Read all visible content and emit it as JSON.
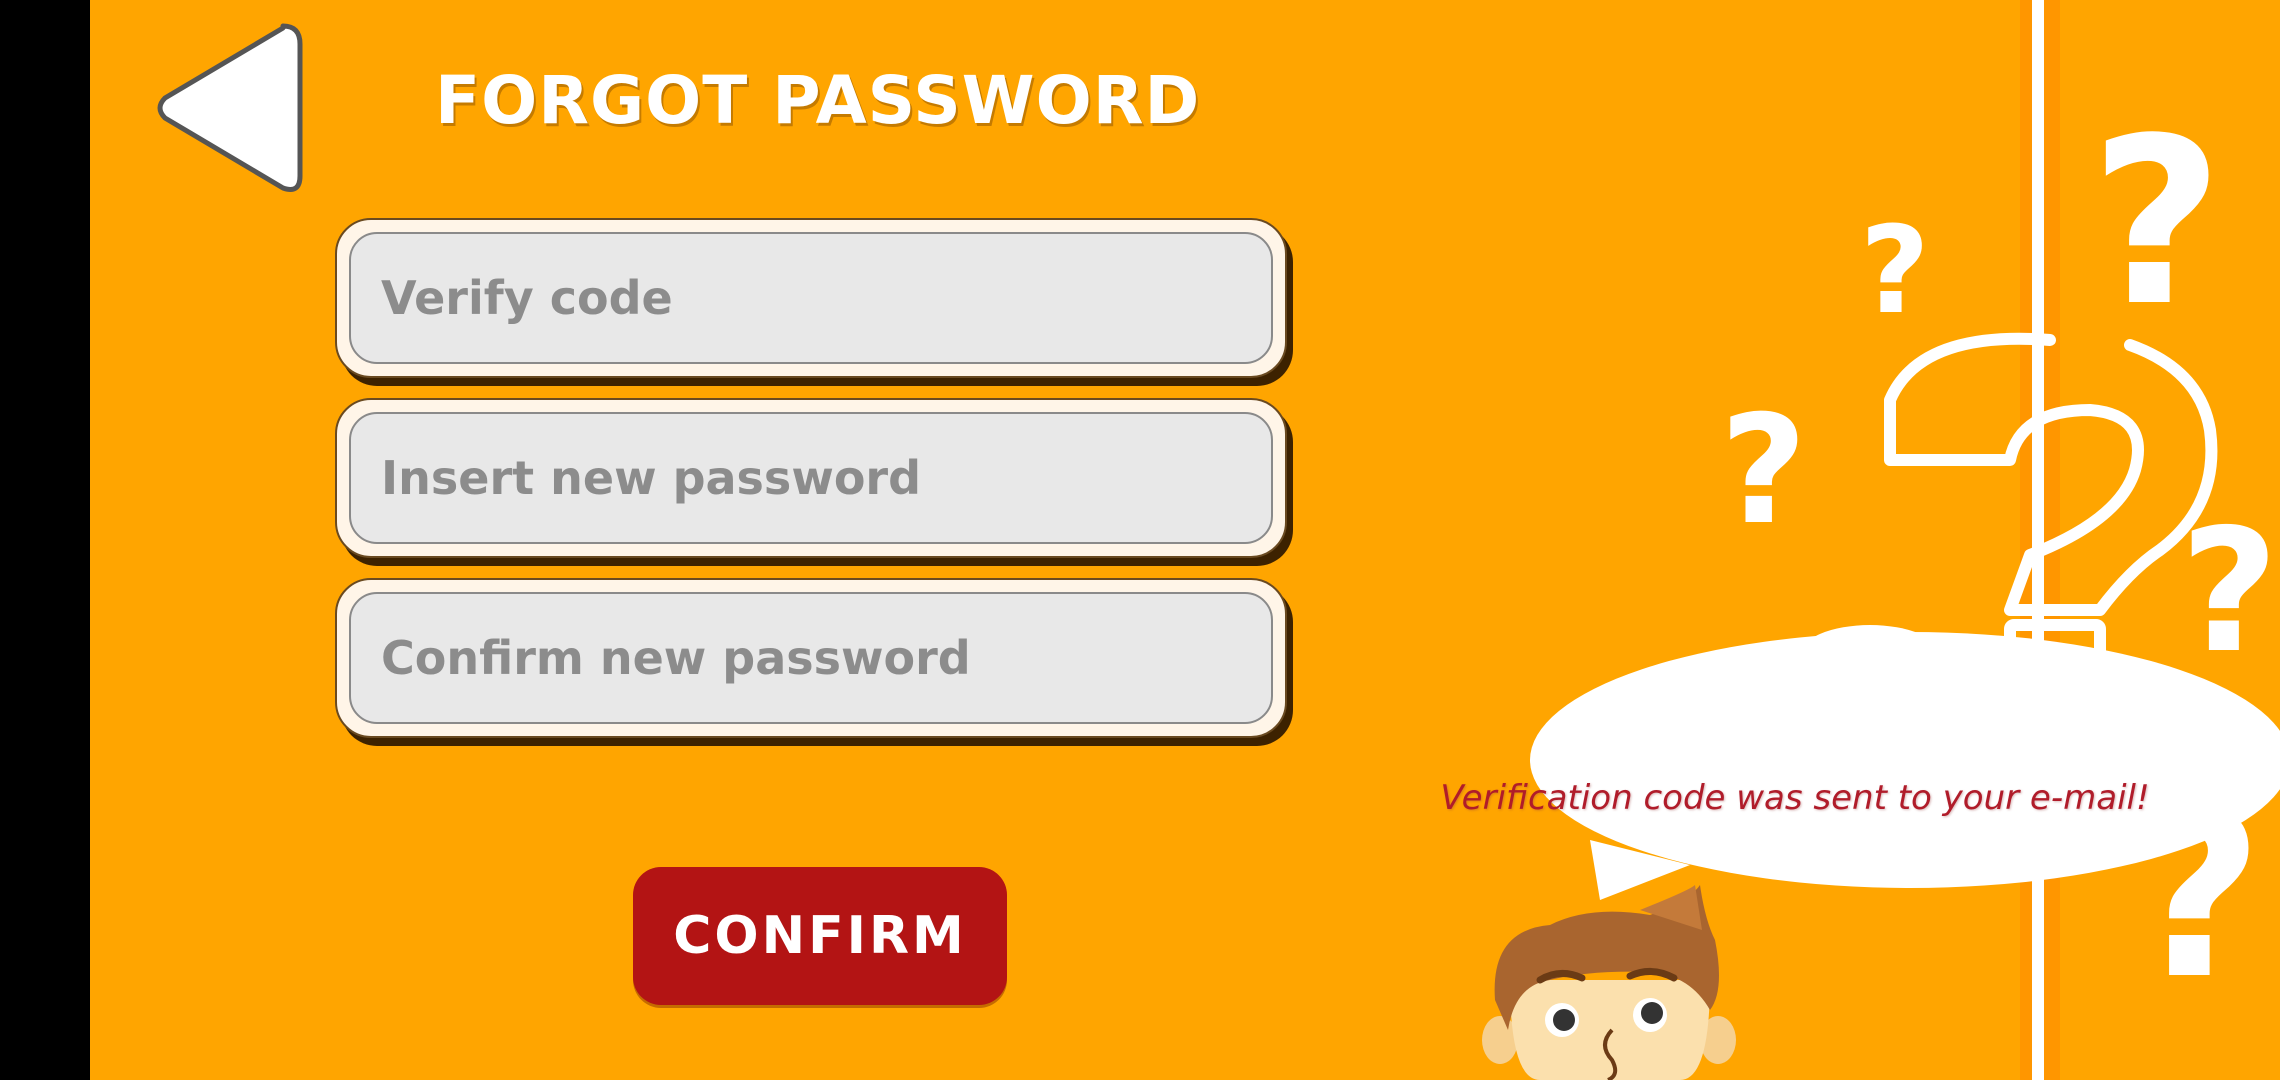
{
  "screen": {
    "title": "FORGOT PASSWORD",
    "back_button": {
      "icon": "back-arrow-icon"
    }
  },
  "form": {
    "verify_code": {
      "value": "",
      "placeholder": "Verify code"
    },
    "new_password": {
      "value": "",
      "placeholder": "Insert new password"
    },
    "confirm_password": {
      "value": "",
      "placeholder": "Confirm new password"
    }
  },
  "confirm_button": {
    "label": "CONFIRM"
  },
  "illustration": {
    "bubble_text": "Verification code was sent  to your e-mail!",
    "character": "thinking-boy-illustration",
    "decor": "question-marks-decor"
  },
  "colors": {
    "background": "#FFA500",
    "button": "#b31414",
    "bubble_text": "#b01c2a",
    "letterbox": "#000000"
  }
}
